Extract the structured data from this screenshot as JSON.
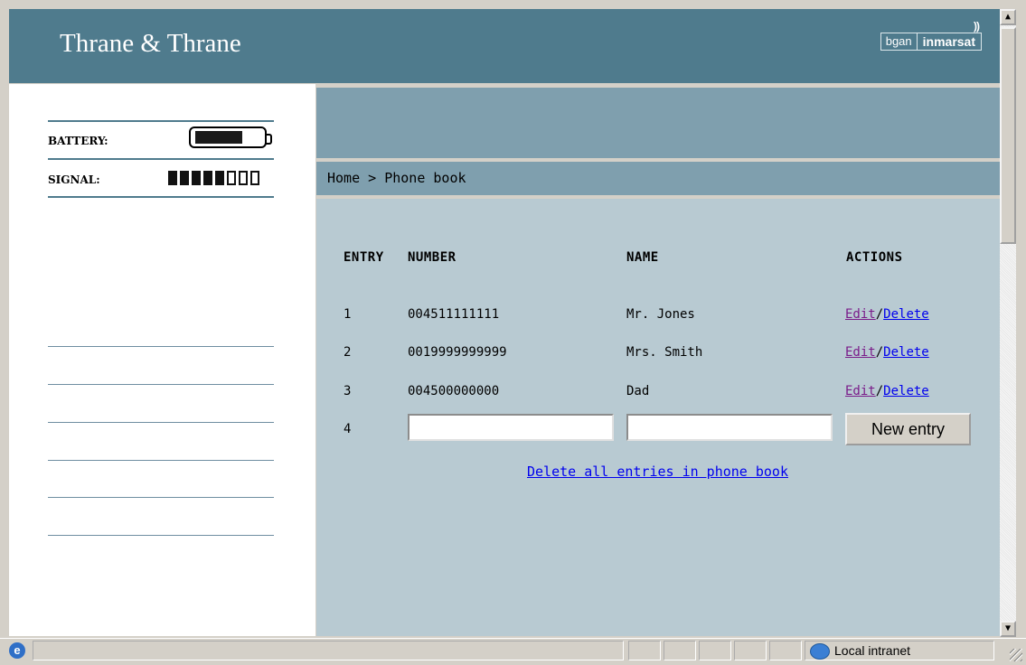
{
  "header": {
    "brand": "Thrane & Thrane",
    "partner_left": "bgan",
    "partner_right": "inmarsat",
    "partner_waves": "))"
  },
  "sidebar": {
    "battery_label": "BATTERY:",
    "signal_label": "SIGNAL:",
    "battery_level": 0.65,
    "signal_bars_on": 5,
    "signal_bars_total": 8
  },
  "breadcrumb": "Home > Phone book",
  "table": {
    "headers": [
      "ENTRY",
      "NUMBER",
      "NAME",
      "ACTIONS"
    ],
    "rows": [
      {
        "entry": "1",
        "number": "004511111111",
        "name": "Mr. Jones",
        "edit": "Edit",
        "sep": "/",
        "delete": "Delete"
      },
      {
        "entry": "2",
        "number": "0019999999999",
        "name": "Mrs. Smith",
        "edit": "Edit",
        "sep": "/",
        "delete": "Delete"
      },
      {
        "entry": "3",
        "number": "004500000000",
        "name": "Dad",
        "edit": "Edit",
        "sep": "/",
        "delete": "Delete"
      }
    ],
    "new_row": {
      "entry": "4",
      "number_value": "",
      "name_value": "",
      "button": "New entry"
    }
  },
  "delete_all": "Delete all entries in phone book",
  "statusbar": {
    "zone": "Local intranet",
    "ie_icon": "e"
  },
  "colors": {
    "header": "#4f7b8d",
    "band": "#7f9fae",
    "content": "#b8cad2",
    "link": "#0000ee",
    "visited": "#7a1c8a"
  }
}
